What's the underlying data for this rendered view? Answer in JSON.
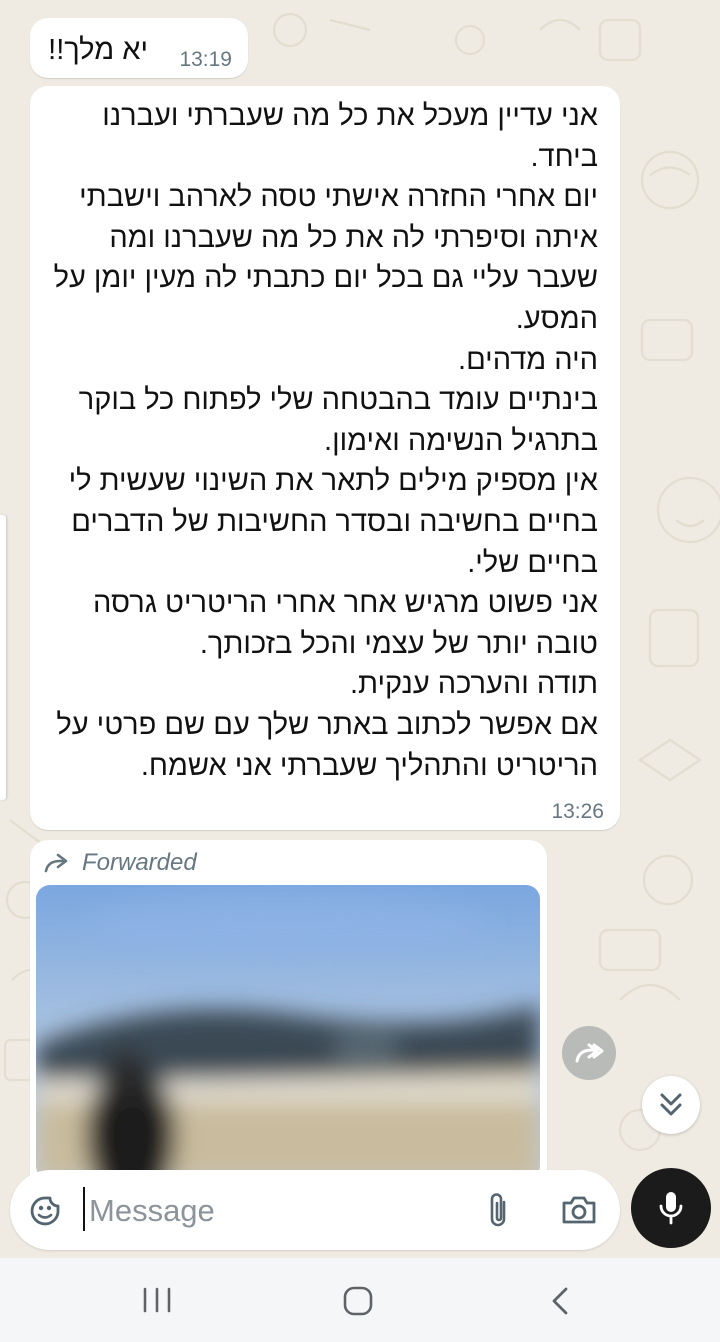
{
  "messages": [
    {
      "type": "text",
      "text": "יא מלך!!",
      "time": "13:19"
    },
    {
      "type": "text",
      "lines": [
        "אני עדיין מעכל את כל מה שעברתי ועברנו",
        "ביחד.",
        "יום אחרי החזרה אישתי טסה לארהב וישבתי",
        "איתה וסיפרתי לה את כל מה שעברנו ומה",
        "שעבר עליי גם בכל יום כתבתי לה מעין יומן על",
        "המסע.",
        "היה מדהים.",
        "בינתיים עומד בהבטחה שלי לפתוח כל בוקר",
        "בתרגיל הנשימה ואימון.",
        "אין מספיק מילים לתאר את השינוי שעשית לי",
        "בחיים בחשיבה ובסדר החשיבות של הדברים",
        "בחיים שלי.",
        "אני פשוט מרגיש אחר אחרי הריטריט גרסה",
        "טובה יותר של עצמי והכל בזכותך.",
        "תודה והערכה ענקית.",
        "אם אפשר לכתוב באתר שלך עם שם פרטי על",
        "הריטריט והתהליך שעברתי אני אשמח."
      ],
      "time": "13:26"
    },
    {
      "type": "image",
      "forwarded_label": "Forwarded"
    }
  ],
  "composer": {
    "placeholder": "Message",
    "icons": [
      "sticker-icon",
      "paperclip-icon",
      "camera-icon",
      "microphone-icon"
    ]
  },
  "floating": {
    "icons": [
      "share-forward-icon",
      "double-chevron-down-icon"
    ]
  },
  "navbar": {
    "icons": [
      "recents-icon",
      "home-icon",
      "back-icon"
    ]
  },
  "colors": {
    "chat_background": "#efeae2",
    "bubble": "#ffffff",
    "timestamp": "#667781",
    "mic_button": "#1b1b1b",
    "navbar": "#f5f6f7"
  }
}
